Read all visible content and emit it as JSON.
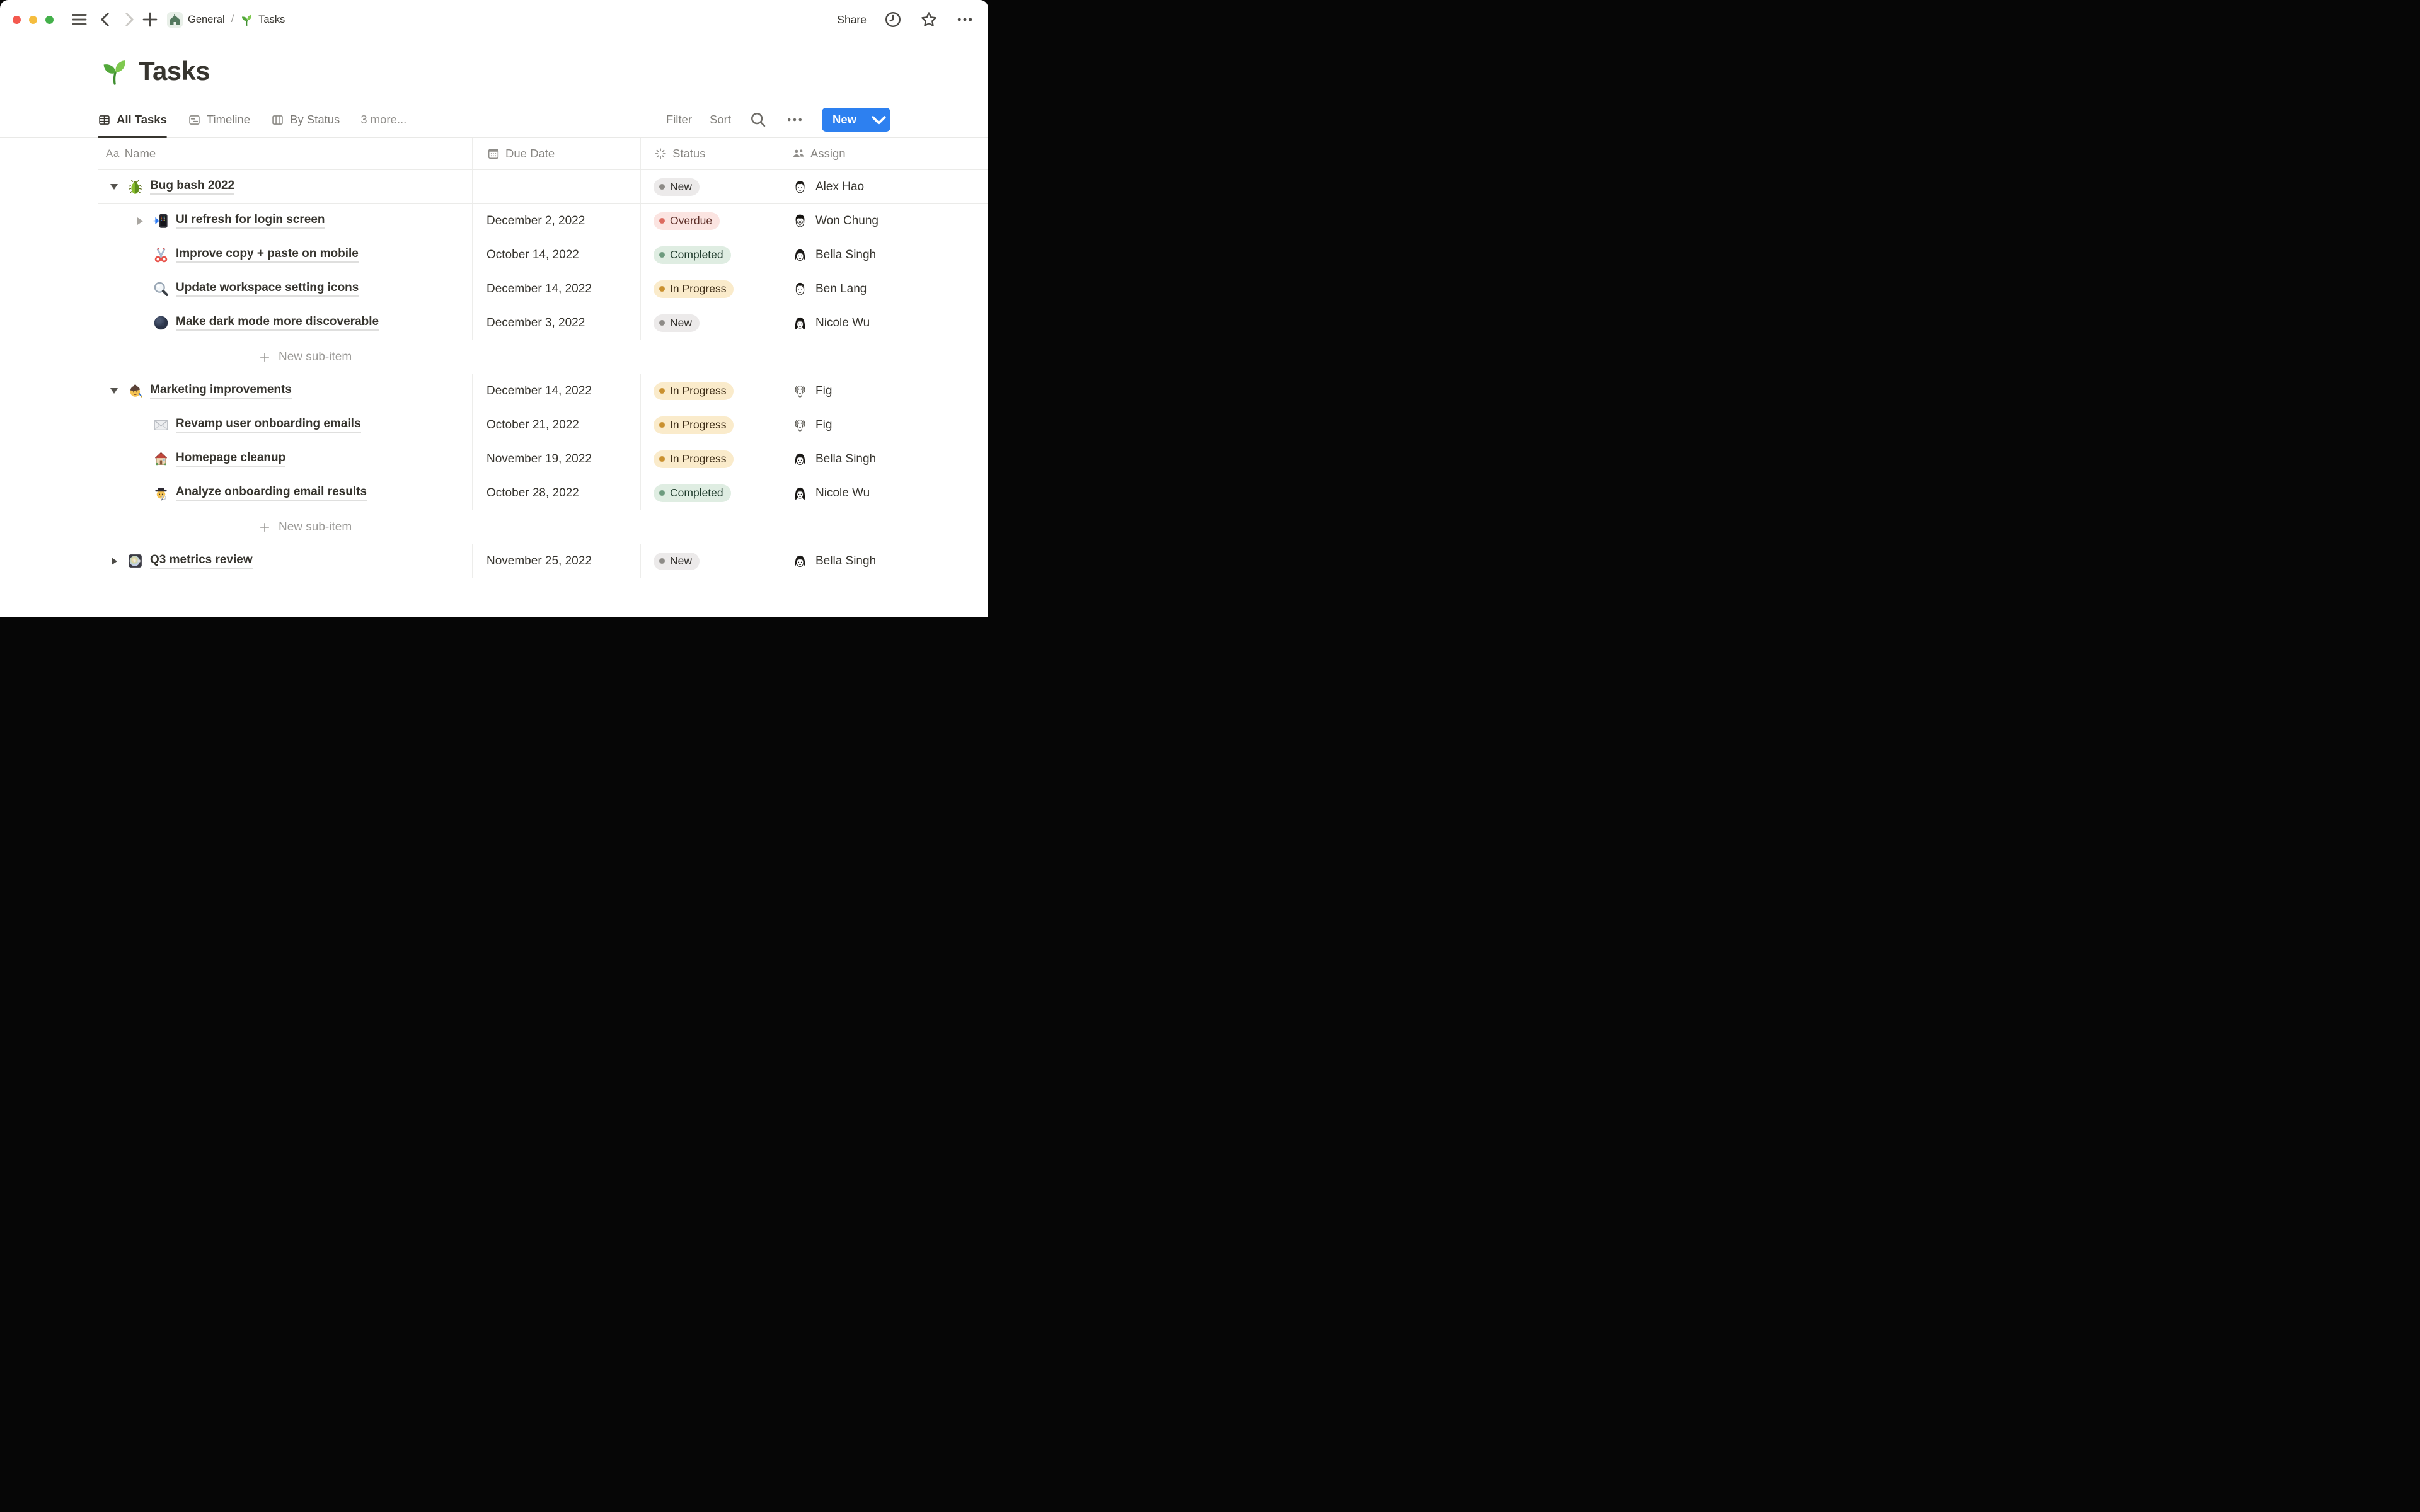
{
  "accent_color": "#2D80F0",
  "window": {
    "traffic_lights": [
      {
        "name": "close",
        "color": "#F4594F"
      },
      {
        "name": "minimize",
        "color": "#F5BD3E"
      },
      {
        "name": "zoom",
        "color": "#43B04A"
      }
    ]
  },
  "topbar": {
    "breadcrumb": [
      {
        "icon": "teamspace-home",
        "label": "General"
      },
      {
        "icon": "seedling",
        "label": "Tasks"
      }
    ],
    "separator": "/",
    "share_label": "Share",
    "right_icons": [
      "clock",
      "star",
      "ellipsis"
    ]
  },
  "page": {
    "icon": "seedling",
    "title": "Tasks"
  },
  "viewbar": {
    "tabs": [
      {
        "icon": "table",
        "label": "All Tasks",
        "active": true
      },
      {
        "icon": "timeline",
        "label": "Timeline",
        "active": false
      },
      {
        "icon": "board",
        "label": "By Status",
        "active": false
      }
    ],
    "more_views_label": "3 more...",
    "filter_label": "Filter",
    "sort_label": "Sort",
    "icons": [
      "search",
      "ellipsis"
    ],
    "new_button_label": "New"
  },
  "table": {
    "columns": [
      {
        "icon": "text",
        "label": "Name"
      },
      {
        "icon": "calendar",
        "label": "Due Date"
      },
      {
        "icon": "status-spinner",
        "label": "Status"
      },
      {
        "icon": "people",
        "label": "Assign"
      }
    ],
    "status_styles": {
      "New": {
        "bg": "#ECEAEA",
        "dot": "#8D8B87",
        "text": "#34322E"
      },
      "Overdue": {
        "bg": "#FBE4E1",
        "dot": "#DC6B60",
        "text": "#5E2E28"
      },
      "Completed": {
        "bg": "#DFEDE2",
        "dot": "#6D9B7E",
        "text": "#1E3A2B"
      },
      "In Progress": {
        "bg": "#FAEBCB",
        "dot": "#C9902F",
        "text": "#3F2E18"
      }
    },
    "rows": [
      {
        "type": "task",
        "level": 1,
        "toggle": "open",
        "icon": "beetle",
        "name": "Bug bash 2022",
        "due": "",
        "status": "New",
        "assignee": "Alex Hao",
        "avatar": "alex-hao"
      },
      {
        "type": "task",
        "level": 2,
        "toggle": "closed",
        "icon": "mobile-phone-arrow",
        "name": "UI refresh for login screen",
        "due": "December 2, 2022",
        "status": "Overdue",
        "assignee": "Won Chung",
        "avatar": "won-chung"
      },
      {
        "type": "task",
        "level": 2,
        "toggle": "none",
        "icon": "scissors",
        "name": "Improve copy + paste on mobile",
        "due": "October 14, 2022",
        "status": "Completed",
        "assignee": "Bella Singh",
        "avatar": "bella-singh"
      },
      {
        "type": "task",
        "level": 2,
        "toggle": "none",
        "icon": "magnifier",
        "name": "Update workspace setting icons",
        "due": "December 14, 2022",
        "status": "In Progress",
        "assignee": "Ben Lang",
        "avatar": "ben-lang"
      },
      {
        "type": "task",
        "level": 2,
        "toggle": "none",
        "icon": "new-moon",
        "name": "Make dark mode more discoverable",
        "due": "December 3, 2022",
        "status": "New",
        "assignee": "Nicole Wu",
        "avatar": "nicole-wu"
      },
      {
        "type": "new-sub-item",
        "label": "New sub-item"
      },
      {
        "type": "task",
        "level": 1,
        "toggle": "open",
        "icon": "artist",
        "name": "Marketing improvements",
        "due": "December 14, 2022",
        "status": "In Progress",
        "assignee": "Fig",
        "avatar": "fig-dog"
      },
      {
        "type": "task",
        "level": 2,
        "toggle": "none",
        "icon": "envelope",
        "name": "Revamp user onboarding emails",
        "due": "October 21, 2022",
        "status": "In Progress",
        "assignee": "Fig",
        "avatar": "fig-dog"
      },
      {
        "type": "task",
        "level": 2,
        "toggle": "none",
        "icon": "house",
        "name": "Homepage cleanup",
        "due": "November 19, 2022",
        "status": "In Progress",
        "assignee": "Bella Singh",
        "avatar": "bella-singh"
      },
      {
        "type": "task",
        "level": 2,
        "toggle": "none",
        "icon": "detective",
        "name": "Analyze onboarding email results",
        "due": "October 28, 2022",
        "status": "Completed",
        "assignee": "Nicole Wu",
        "avatar": "nicole-wu"
      },
      {
        "type": "new-sub-item",
        "label": "New sub-item"
      },
      {
        "type": "task",
        "level": 1,
        "toggle": "closed",
        "icon": "minidisc",
        "name": "Q3 metrics review",
        "due": "November 25, 2022",
        "status": "New",
        "assignee": "Bella Singh",
        "avatar": "bella-singh"
      }
    ]
  }
}
